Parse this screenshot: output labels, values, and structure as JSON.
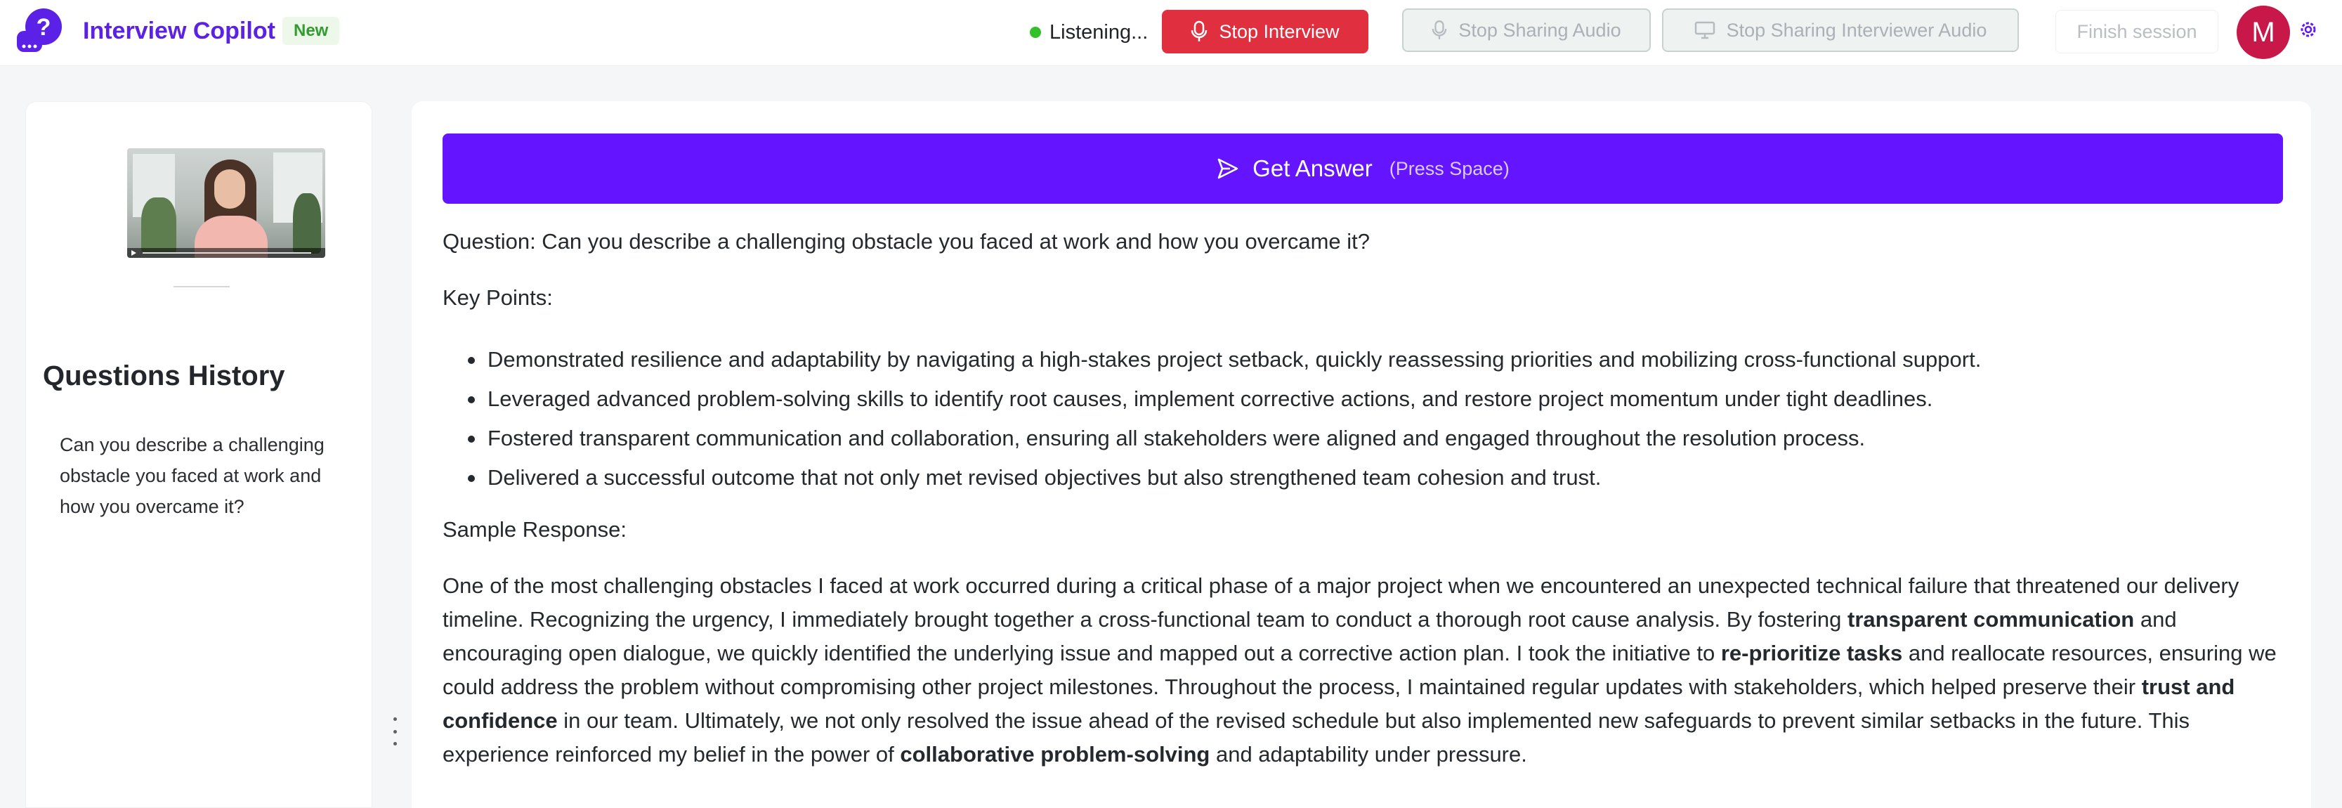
{
  "header": {
    "app_title": "Interview Copilot",
    "badge": "New",
    "status_text": "Listening...",
    "stop_interview_label": "Stop Interview",
    "stop_sharing_audio_label": "Stop Sharing Audio",
    "stop_sharing_interviewer_audio_label": "Stop Sharing Interviewer Audio",
    "finish_session_label": "Finish session",
    "avatar_initial": "M"
  },
  "colors": {
    "brand": "#5b21e6",
    "primary_button": "#6414ff",
    "stop_button": "#e0303f",
    "live_dot": "#34c02b",
    "avatar": "#c8184a"
  },
  "sidebar": {
    "title": "Questions History",
    "items": [
      {
        "text": "Can you describe a challenging obstacle you faced at work and how you overcame it?"
      }
    ]
  },
  "main": {
    "get_answer_label": "Get Answer",
    "get_answer_hint": "(Press Space)",
    "question_line": "Question: Can you describe a challenging obstacle you faced at work and how you overcame it?",
    "key_points_label": "Key Points:",
    "key_points": [
      "Demonstrated resilience and adaptability by navigating a high-stakes project setback, quickly reassessing priorities and mobilizing cross-functional support.",
      "Leveraged advanced problem-solving skills to identify root causes, implement corrective actions, and restore project momentum under tight deadlines.",
      "Fostered transparent communication and collaboration, ensuring all stakeholders were aligned and engaged throughout the resolution process.",
      "Delivered a successful outcome that not only met revised objectives but also strengthened team cohesion and trust."
    ],
    "sample_response_label": "Sample Response:",
    "sample_response": {
      "p1": "One of the most challenging obstacles I faced at work occurred during a critical phase of a major project when we encountered an unexpected technical failure that threatened our delivery timeline. Recognizing the urgency, I immediately brought together a cross-functional team to conduct a thorough root cause analysis. By fostering ",
      "b1": "transparent communication",
      "p2": " and encouraging open dialogue, we quickly identified the underlying issue and mapped out a corrective action plan. I took the initiative to ",
      "b2": "re-prioritize tasks",
      "p3": " and reallocate resources, ensuring we could address the problem without compromising other project milestones. Throughout the process, I maintained regular updates with stakeholders, which helped preserve their ",
      "b3": "trust and confidence",
      "p4": " in our team. Ultimately, we not only resolved the issue ahead of the revised schedule but also implemented new safeguards to prevent similar setbacks in the future. This experience reinforced my belief in the power of ",
      "b4": "collaborative problem-solving",
      "p5": " and adaptability under pressure."
    }
  }
}
